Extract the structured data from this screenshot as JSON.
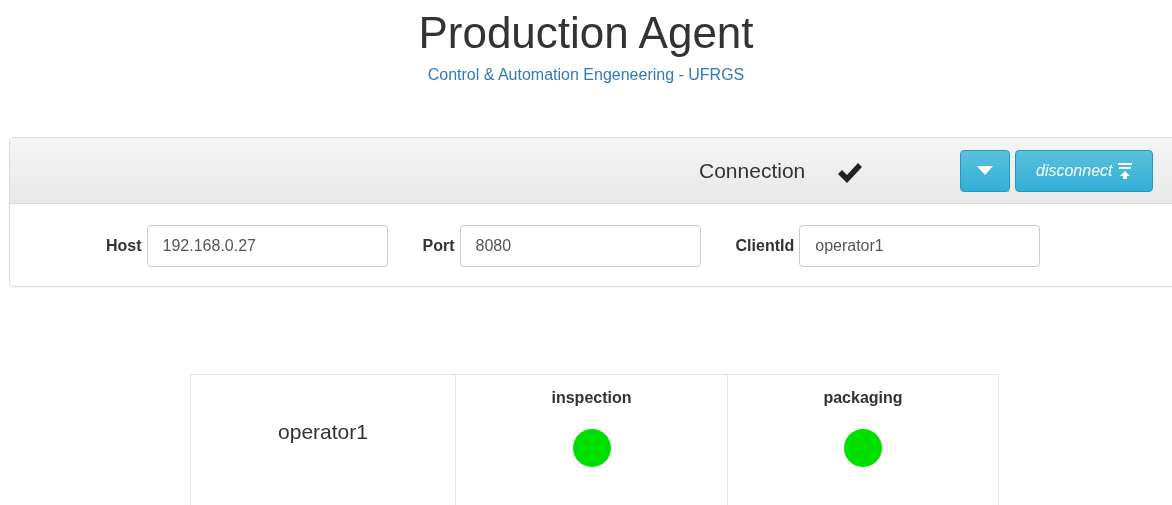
{
  "header": {
    "title": "Production Agent",
    "subtitle": "Control & Automation Engeneering - UFRGS"
  },
  "connection": {
    "title": "Connection",
    "connected": true,
    "disconnect_button": "disconnect",
    "fields": [
      {
        "label": "Host",
        "value": "192.168.0.27"
      },
      {
        "label": "Port",
        "value": "8080"
      },
      {
        "label": "ClientId",
        "value": "operator1"
      }
    ]
  },
  "table": {
    "client": "operator1",
    "stations": [
      {
        "name": "inspection",
        "color": "#00e000"
      },
      {
        "name": "packaging",
        "color": "#00e000"
      }
    ]
  }
}
